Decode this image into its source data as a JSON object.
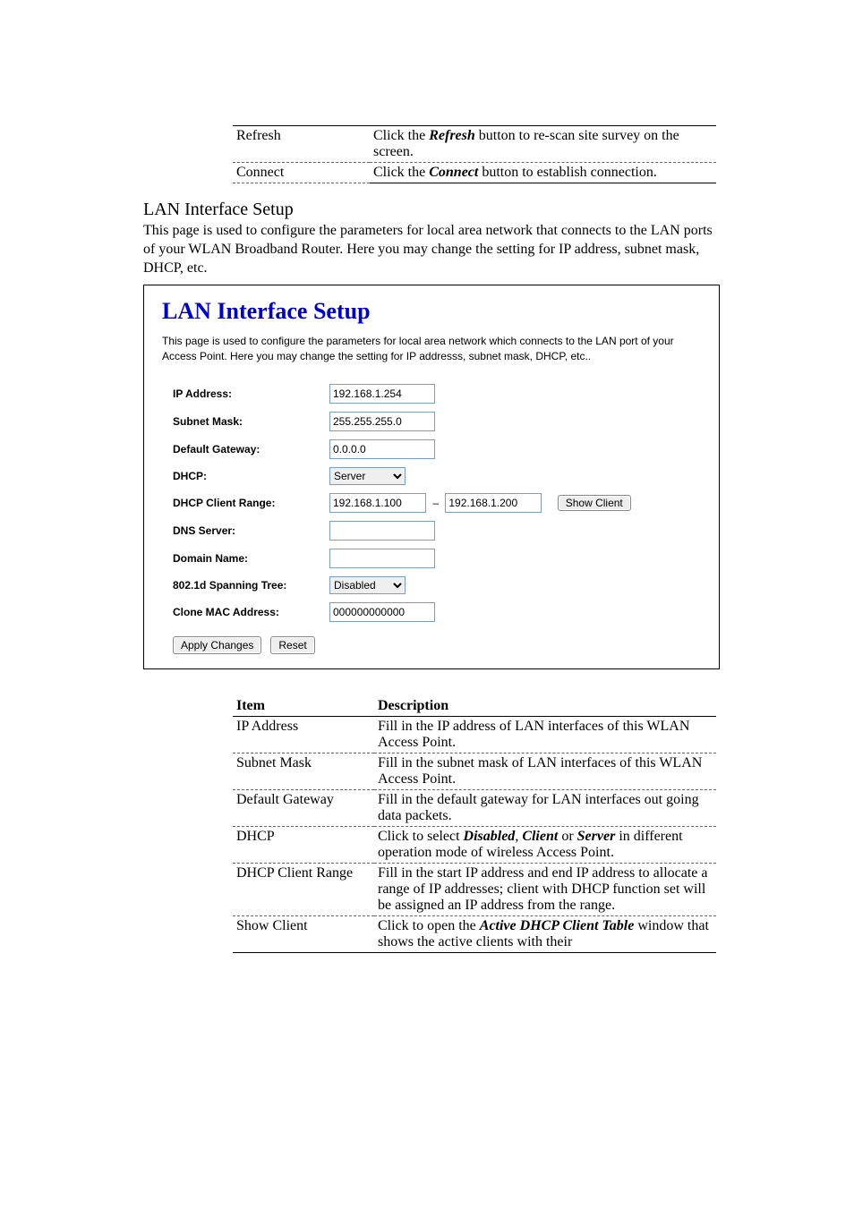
{
  "top_table": {
    "rows": [
      {
        "item": "Refresh",
        "desc_pre": "Click the ",
        "desc_bold": "Refresh",
        "desc_post": " button to re-scan site survey on the screen."
      },
      {
        "item": "Connect",
        "desc_pre": "Click the ",
        "desc_bold": "Connect",
        "desc_post": " button to establish connection."
      }
    ]
  },
  "section": {
    "heading": "LAN Interface Setup",
    "intro": "This page is used to configure the parameters for local area network that connects to the LAN ports of your WLAN Broadband Router. Here you may change the setting for IP address, subnet mask, DHCP, etc."
  },
  "panel": {
    "title": "LAN Interface Setup",
    "subtitle": "This page is used to configure the parameters for local area network which connects to the LAN port of your Access Point. Here you may change the setting for IP addresss, subnet mask, DHCP, etc..",
    "fields": {
      "ip_label": "IP Address:",
      "ip_value": "192.168.1.254",
      "subnet_label": "Subnet Mask:",
      "subnet_value": "255.255.255.0",
      "gateway_label": "Default Gateway:",
      "gateway_value": "0.0.0.0",
      "dhcp_label": "DHCP:",
      "dhcp_value": "Server",
      "range_label": "DHCP Client Range:",
      "range_start": "192.168.1.100",
      "range_dash": "–",
      "range_end": "192.168.1.200",
      "show_client": "Show Client",
      "dns_label": "DNS Server:",
      "dns_value": "",
      "domain_label": "Domain Name:",
      "domain_value": "",
      "spanning_label": "802.1d Spanning Tree:",
      "spanning_value": "Disabled",
      "clone_label": "Clone MAC Address:",
      "clone_value": "000000000000"
    },
    "buttons": {
      "apply": "Apply Changes",
      "reset": "Reset"
    }
  },
  "bottom_table": {
    "head_item": "Item",
    "head_desc": "Description",
    "rows": [
      {
        "item": "IP Address",
        "desc": "Fill in the IP address of LAN interfaces of this WLAN Access Point."
      },
      {
        "item": "Subnet Mask",
        "desc": "Fill in the subnet mask of LAN interfaces of this WLAN Access Point."
      },
      {
        "item": "Default Gateway",
        "desc": "Fill in the default gateway for LAN interfaces out going data packets."
      },
      {
        "item": "DHCP",
        "desc_pre": "Click to select ",
        "bold1": "Disabled",
        "mid1": ", ",
        "bold2": "Client",
        "mid2": " or ",
        "bold3": "Server",
        "desc_post": " in different operation mode of wireless Access Point."
      },
      {
        "item": "DHCP Client Range",
        "desc": "Fill in the start IP address and end IP address to allocate a range of IP addresses; client with DHCP function set will be assigned an IP address from the range."
      },
      {
        "item": "Show Client",
        "desc_pre": "Click to open the ",
        "bold1": "Active DHCP Client Table",
        "desc_post": " window that shows the active clients with their"
      }
    ]
  }
}
